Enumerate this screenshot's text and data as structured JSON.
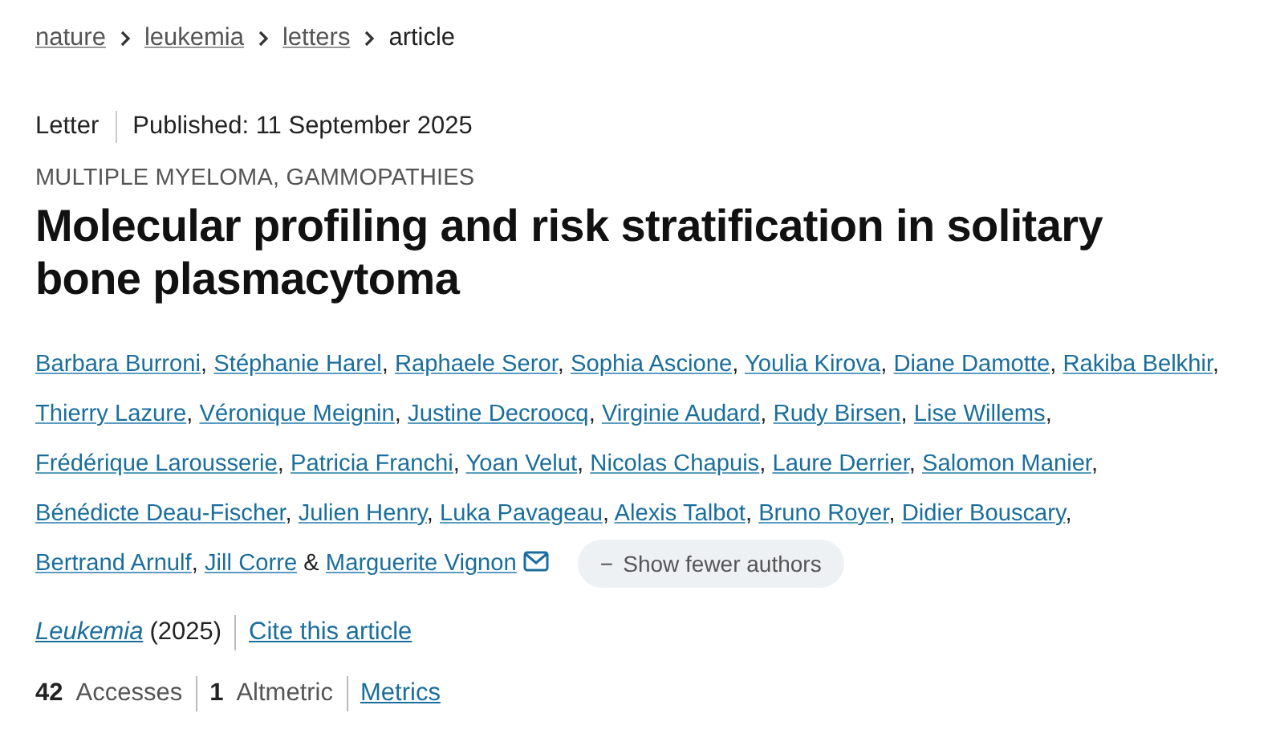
{
  "breadcrumbs": [
    {
      "label": "nature",
      "link": true
    },
    {
      "label": "leukemia",
      "link": true
    },
    {
      "label": "letters",
      "link": true
    },
    {
      "label": "article",
      "link": false
    }
  ],
  "article_type": "Letter",
  "published": "Published: 11 September 2025",
  "subject": "MULTIPLE MYELOMA, GAMMOPATHIES",
  "title": "Molecular profiling and risk stratification in solitary bone plasmacytoma",
  "authors": [
    {
      "name": "Barbara Burroni",
      "separator": ",",
      "corresponding": false
    },
    {
      "name": "Stéphanie Harel",
      "separator": ",",
      "corresponding": false
    },
    {
      "name": "Raphaele Seror",
      "separator": ",",
      "corresponding": false
    },
    {
      "name": "Sophia Ascione",
      "separator": ",",
      "corresponding": false
    },
    {
      "name": "Youlia Kirova",
      "separator": ",",
      "corresponding": false
    },
    {
      "name": "Diane Damotte",
      "separator": ",",
      "corresponding": false
    },
    {
      "name": "Rakiba Belkhir",
      "separator": ",",
      "corresponding": false
    },
    {
      "name": "Thierry Lazure",
      "separator": ",",
      "corresponding": false
    },
    {
      "name": "Véronique Meignin",
      "separator": ",",
      "corresponding": false
    },
    {
      "name": "Justine Decroocq",
      "separator": ",",
      "corresponding": false
    },
    {
      "name": "Virginie Audard",
      "separator": ",",
      "corresponding": false
    },
    {
      "name": "Rudy Birsen",
      "separator": ",",
      "corresponding": false
    },
    {
      "name": "Lise Willems",
      "separator": ",",
      "corresponding": false
    },
    {
      "name": "Frédérique Larousserie",
      "separator": ",",
      "corresponding": false
    },
    {
      "name": "Patricia Franchi",
      "separator": ",",
      "corresponding": false
    },
    {
      "name": "Yoan Velut",
      "separator": ",",
      "corresponding": false
    },
    {
      "name": "Nicolas Chapuis",
      "separator": ",",
      "corresponding": false
    },
    {
      "name": "Laure Derrier",
      "separator": ",",
      "corresponding": false
    },
    {
      "name": "Salomon Manier",
      "separator": ",",
      "corresponding": false
    },
    {
      "name": "Bénédicte Deau-Fischer",
      "separator": ",",
      "corresponding": false
    },
    {
      "name": "Julien Henry",
      "separator": ",",
      "corresponding": false
    },
    {
      "name": "Luka Pavageau",
      "separator": ",",
      "corresponding": false
    },
    {
      "name": "Alexis Talbot",
      "separator": ",",
      "corresponding": false
    },
    {
      "name": "Bruno Royer",
      "separator": ",",
      "corresponding": false
    },
    {
      "name": "Didier Bouscary",
      "separator": ",",
      "corresponding": false
    },
    {
      "name": "Bertrand Arnulf",
      "separator": ",",
      "corresponding": false
    },
    {
      "name": "Jill Corre",
      "separator": "&",
      "corresponding": false
    },
    {
      "name": "Marguerite Vignon",
      "corresponding": true
    }
  ],
  "authors_toggle": {
    "label": "Show fewer authors",
    "sign": "−"
  },
  "citation": {
    "journal": "Leukemia",
    "year": "(2025)",
    "cite_link": "Cite this article"
  },
  "metrics": [
    {
      "count": "42",
      "label": "Accesses"
    },
    {
      "count": "1",
      "label": "Altmetric"
    }
  ],
  "metrics_link": "Metrics"
}
